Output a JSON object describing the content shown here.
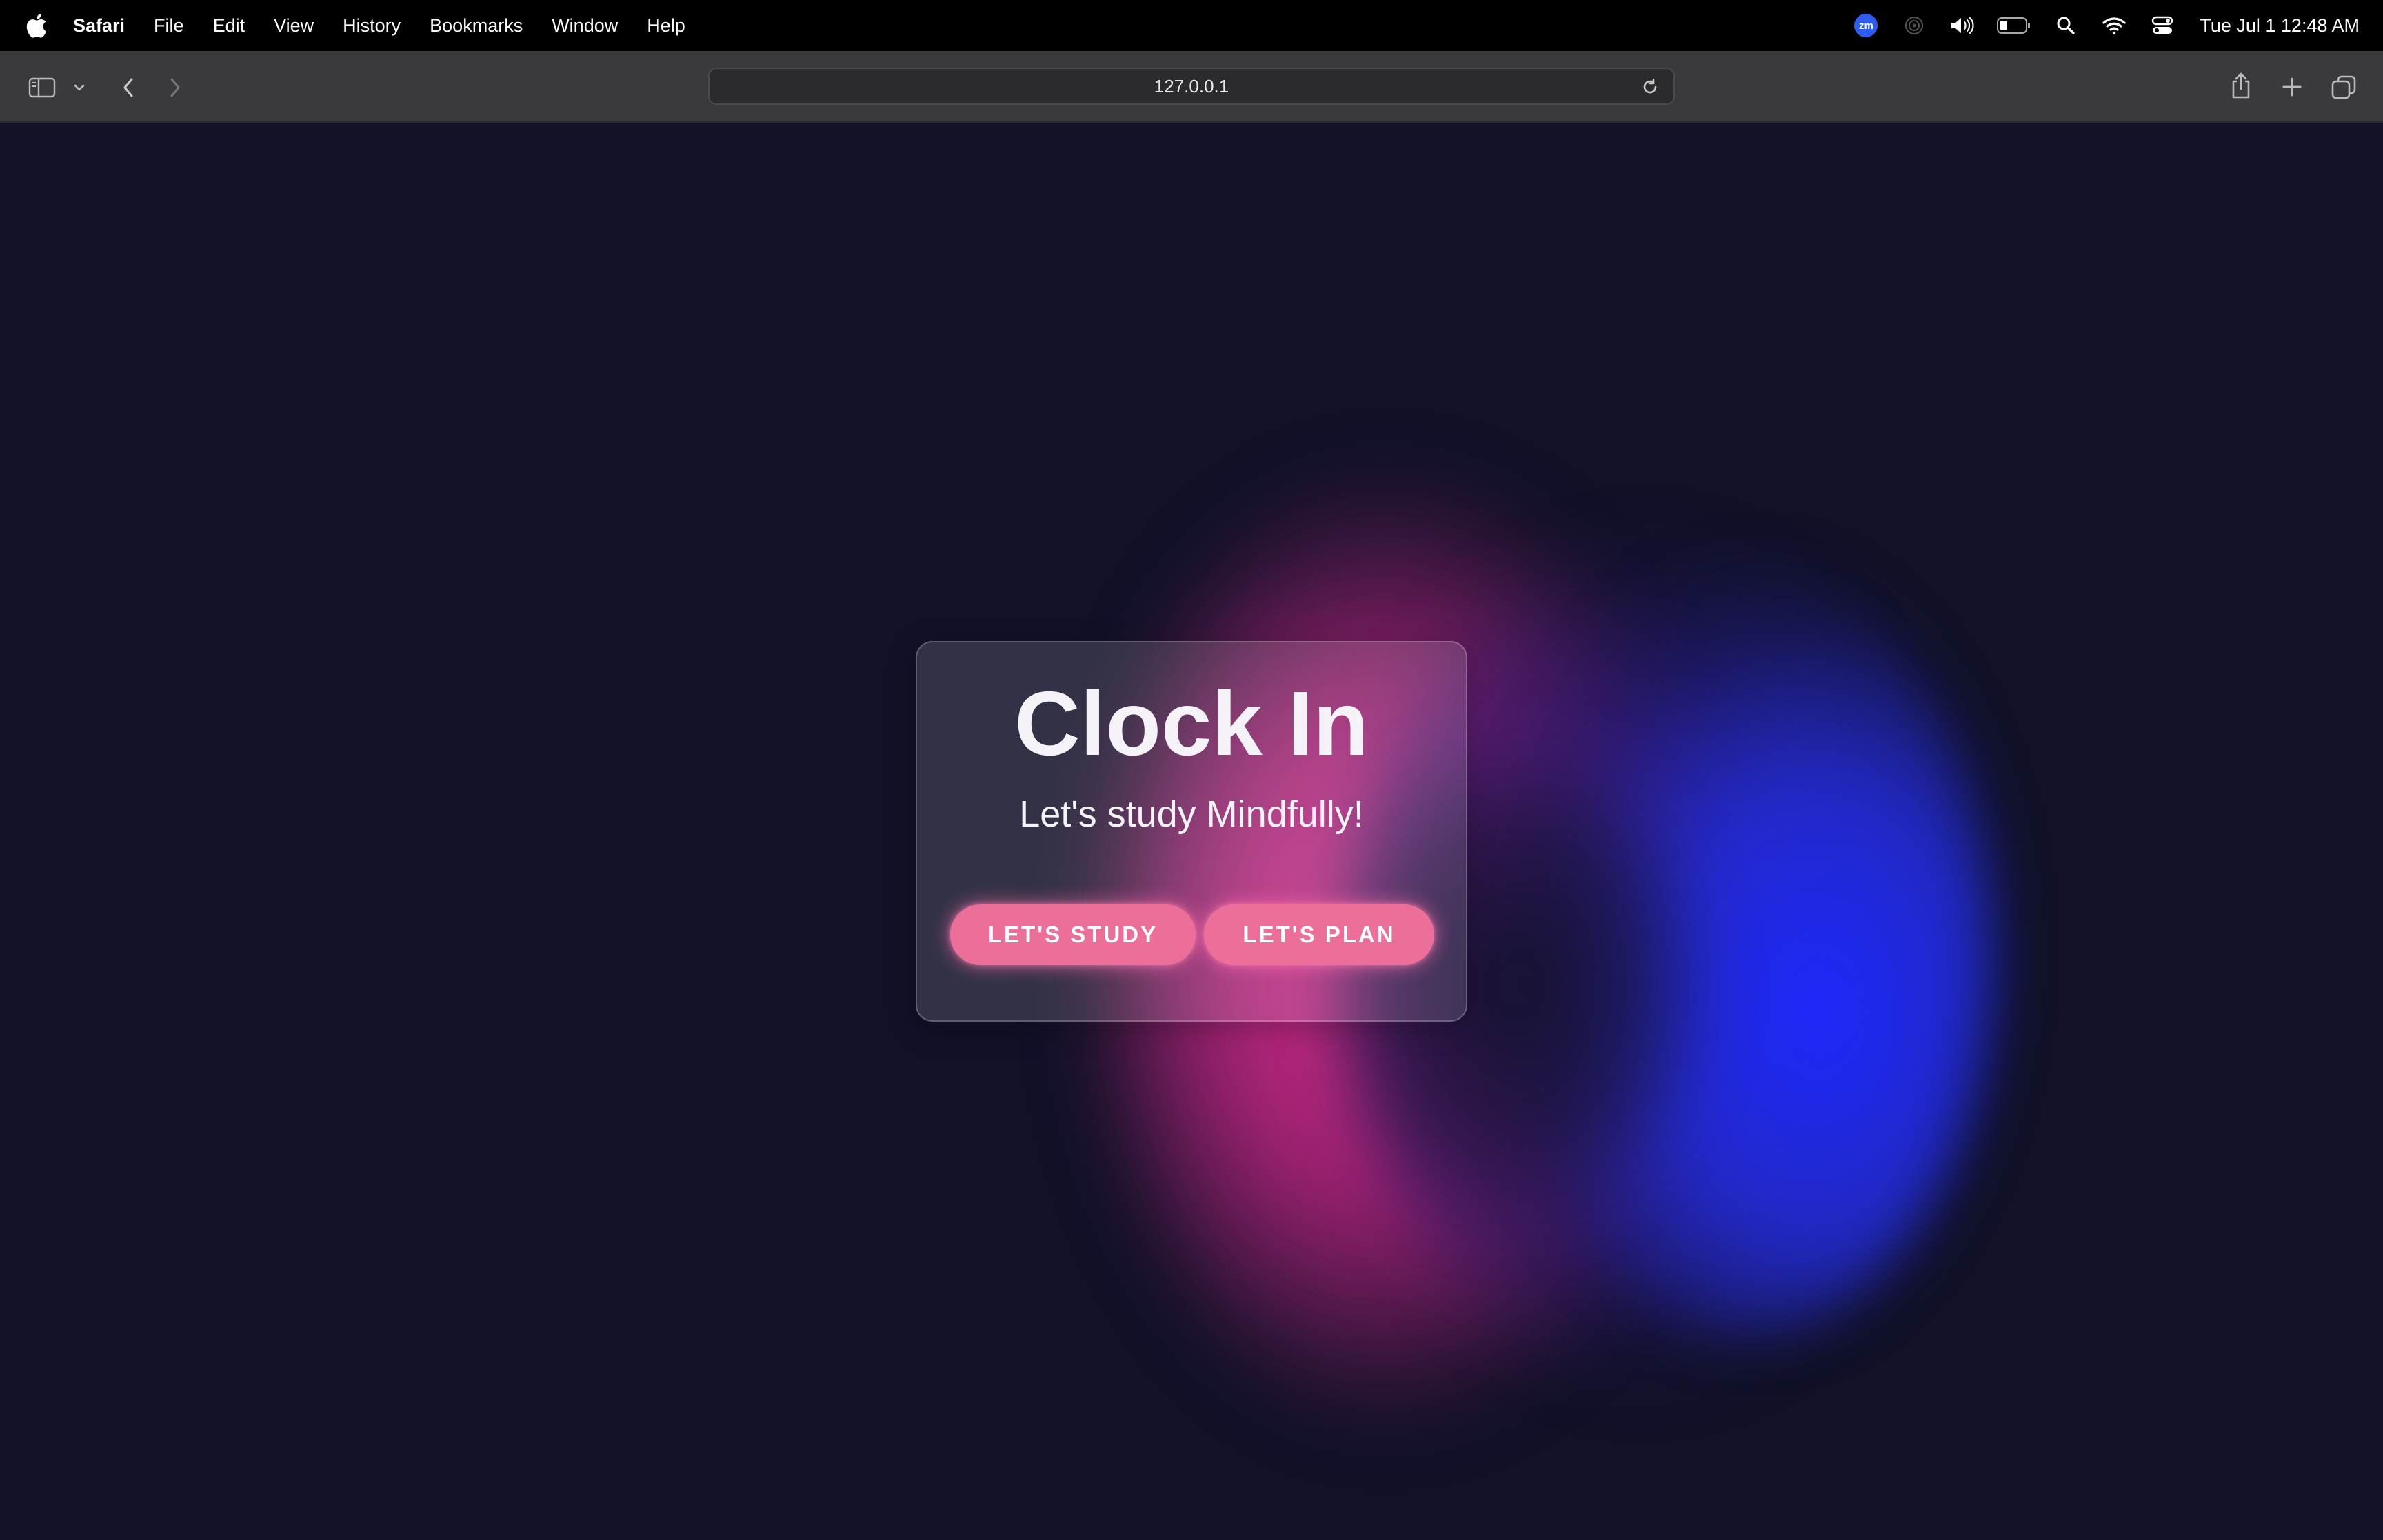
{
  "menubar": {
    "app_name": "Safari",
    "items": [
      "File",
      "Edit",
      "View",
      "History",
      "Bookmarks",
      "Window",
      "Help"
    ],
    "status_icons": [
      "zoom-icon",
      "airdrop-icon",
      "volume-icon",
      "battery-icon",
      "spotlight-search-icon",
      "wifi-icon",
      "control-center-icon"
    ],
    "zoom_badge": "zm",
    "clock": "Tue Jul 1  12:48 AM"
  },
  "toolbar": {
    "address": "127.0.0.1",
    "icons": [
      "sidebar-toggle-icon",
      "chevron-down-icon",
      "back-icon",
      "forward-icon",
      "reload-icon",
      "share-icon",
      "new-tab-icon",
      "tab-overview-icon"
    ]
  },
  "page": {
    "title": "Clock In",
    "subtitle": "Let's study Mindfully!",
    "buttons": {
      "study": "LET'S STUDY",
      "plan": "LET'S PLAN"
    }
  },
  "colors": {
    "background": "#111128",
    "accent_pink": "#ec6f9a",
    "blob_pink": "#ec3496",
    "blob_blue": "#1e28ff"
  }
}
